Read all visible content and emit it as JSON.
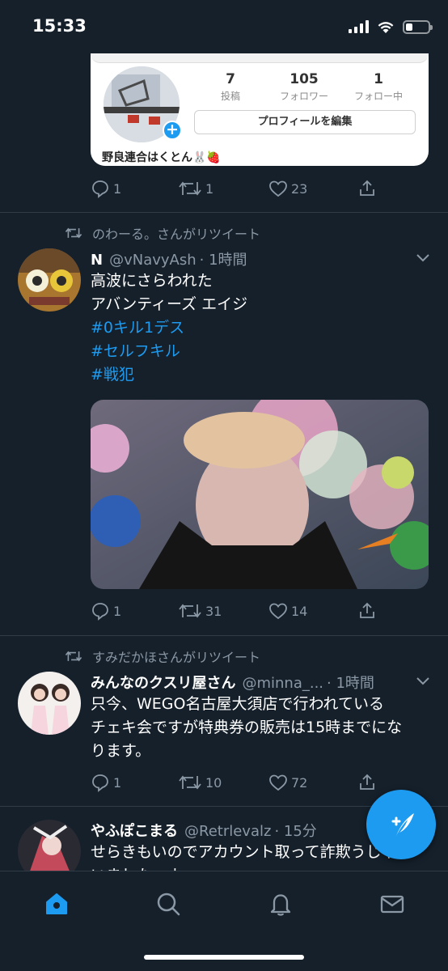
{
  "status_bar": {
    "time": "15:33",
    "battery_level": 0.3
  },
  "tweets": [
    {
      "embed": {
        "stats": [
          {
            "value": "7",
            "label": "投稿"
          },
          {
            "value": "105",
            "label": "フォロワー"
          },
          {
            "value": "1",
            "label": "フォロー中"
          }
        ],
        "edit_button": "プロフィールを編集",
        "profile_name": "野良連合はくとん🐰🍓"
      },
      "actions": {
        "reply": "1",
        "retweet": "1",
        "like": "23"
      }
    },
    {
      "retweeted_by": "のわーる。さんがリツイート",
      "name": "N",
      "handle": "@vNavyAsh",
      "time": "· 1時間",
      "lines": [
        "高波にさらわれた",
        "アバンティーズ エイジ"
      ],
      "hashtags": [
        "#0キル1デス",
        "#セルフキル",
        "#戦犯"
      ],
      "actions": {
        "reply": "1",
        "retweet": "31",
        "like": "14"
      }
    },
    {
      "retweeted_by": "すみだかほさんがリツイート",
      "name": "みんなのクスリ屋さん",
      "handle": "@minna_...",
      "time": "· 1時間",
      "lines": [
        "只今、WEGO名古屋大須店で行われている",
        "チェキ会ですが特典券の販売は15時までにな",
        "ります。"
      ],
      "actions": {
        "reply": "1",
        "retweet": "10",
        "like": "72"
      }
    },
    {
      "name": "やふぽこまる",
      "handle": "@Retrlevalz",
      "time": "· 15分",
      "lines": [
        "せらきもいのでアカウント取って詐欺うじゃ",
        "いました〜よ"
      ]
    }
  ],
  "colors": {
    "background": "#15202b",
    "accent": "#1d9bf0",
    "muted": "#8b98a5",
    "divider": "#2f3b47"
  },
  "tabs": [
    {
      "icon": "home-icon",
      "active": true
    },
    {
      "icon": "search-icon",
      "active": false
    },
    {
      "icon": "bell-icon",
      "active": false
    },
    {
      "icon": "mail-icon",
      "active": false
    }
  ],
  "fab": {
    "icon": "compose-icon"
  }
}
